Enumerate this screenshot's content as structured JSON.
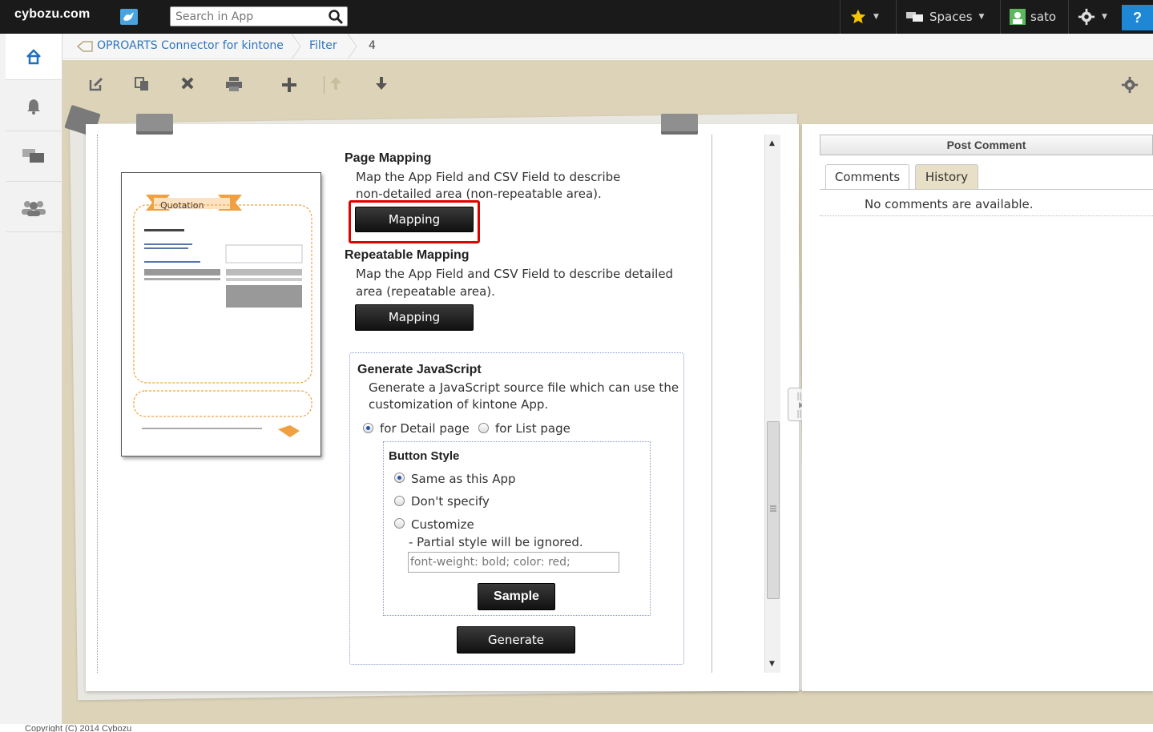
{
  "topbar": {
    "logo": "cybozu.com",
    "search_placeholder": "Search in App",
    "spaces_label": "Spaces",
    "user_name": "sato",
    "help_label": "?"
  },
  "breadcrumb": {
    "app": "OPROARTS Connector for kintone",
    "view": "Filter",
    "record": "4"
  },
  "form": {
    "page_mapping": {
      "title": "Page Mapping",
      "desc_line1": "Map the App Field and CSV Field to describe",
      "desc_line2": "non-detailed area (non-repeatable area).",
      "button": "Mapping"
    },
    "repeat_mapping": {
      "title": "Repeatable Mapping",
      "desc_line1": "Map the App Field and CSV Field to describe detailed",
      "desc_line2": "area (repeatable area).",
      "button": "Mapping"
    },
    "generate_js": {
      "title": "Generate JavaScript",
      "desc_line1": "Generate a JavaScript source file which can use the",
      "desc_line2": "customization of kintone App.",
      "opt_detail": "for Detail page",
      "opt_list": "for List page",
      "selected": "for Detail page",
      "button_style": {
        "title": "Button Style",
        "opt_same": "Same as this App",
        "opt_none": "Don't specify",
        "opt_custom": "Customize",
        "selected": "Same as this App",
        "note": "- Partial style will be ignored.",
        "style_value": "font-weight: bold; color: red;",
        "sample_button": "Sample"
      },
      "generate_button": "Generate"
    }
  },
  "preview": {
    "doc_title": "Quotation"
  },
  "comments": {
    "post_button": "Post Comment",
    "tab_comments": "Comments",
    "tab_history": "History",
    "empty_text": "No comments are available."
  },
  "footer": {
    "copyright": "Copyright (C) 2014 Cybozu"
  },
  "colors": {
    "accent": "#1e88d6",
    "highlight": "#e00000",
    "page_bg": "#dcd3b9"
  }
}
